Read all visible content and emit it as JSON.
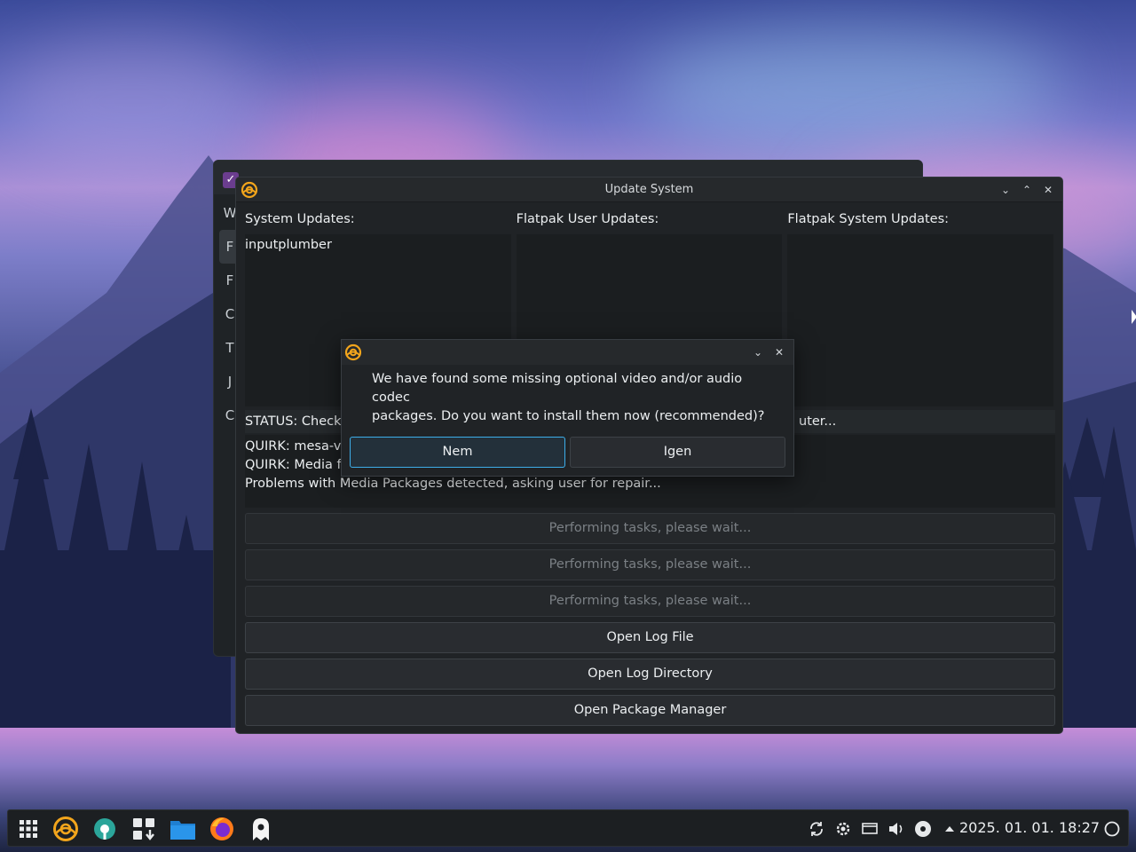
{
  "main_window": {
    "title": "Update System",
    "panels": [
      {
        "label": "System Updates:",
        "items": [
          "inputplumber"
        ]
      },
      {
        "label": "Flatpak User Updates:",
        "items": []
      },
      {
        "label": "Flatpak System Updates:",
        "items": []
      }
    ],
    "status_text": "STATUS: Checkir",
    "status_tail": "uter...",
    "log_lines": [
      "QUIRK: mesa-vu",
      "QUIRK: Media fi",
      "Problems with Media Packages detected, asking user for repair..."
    ],
    "progress_buttons": [
      "Performing tasks, please wait...",
      "Performing tasks, please wait...",
      "Performing tasks, please wait..."
    ],
    "open_log_file": "Open Log File",
    "open_log_directory": "Open Log Directory",
    "open_package_manager": "Open Package Manager"
  },
  "background_window": {
    "sidebar_letters": [
      "W",
      "F",
      "F",
      "C",
      "T",
      "J",
      "C"
    ]
  },
  "dialog": {
    "message_line1": "We have found some missing optional video and/or audio codec",
    "message_line2": "packages. Do you want to install them now (recommended)?",
    "no_label": "Nem",
    "yes_label": "Igen"
  },
  "taskbar": {
    "clock": "2025. 01. 01. 18:27",
    "apps": [
      "app-launcher-icon",
      "nobara-welcome-icon",
      "system-config-icon",
      "software-center-icon",
      "file-manager-icon",
      "firefox-icon",
      "nobara-ghost-icon"
    ],
    "tray": [
      "sync-icon",
      "settings-tray-icon",
      "display-icon",
      "volume-icon",
      "media-disc-icon",
      "expand-tray-icon"
    ]
  },
  "colors": {
    "accent": "#3daee9",
    "window_bg": "#202326",
    "logo_orange": "#f2a51c"
  }
}
